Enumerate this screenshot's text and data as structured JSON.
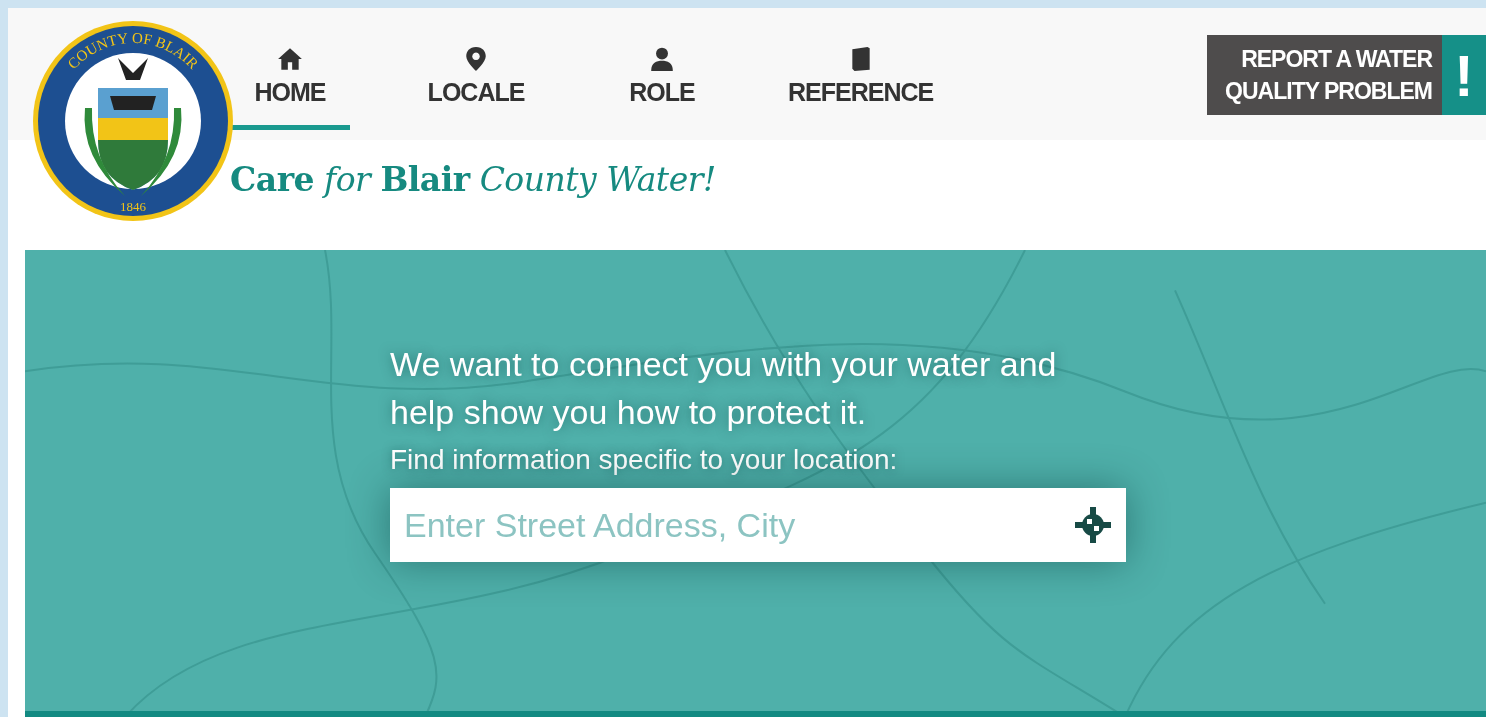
{
  "logo": {
    "top_text": "COUNTY OF BLAIR",
    "year": "1846"
  },
  "nav": [
    {
      "label": "HOME",
      "selected": true
    },
    {
      "label": "LOCALE",
      "selected": false
    },
    {
      "label": "ROLE",
      "selected": false
    },
    {
      "label": "REFERENCE",
      "selected": false
    }
  ],
  "report_button": {
    "label_line_1": "REPORT A WATER",
    "label_line_2": "QUALITY PROBLEM",
    "mark": "!"
  },
  "tagline": "**Care** *for* **Blair** *County Water!*",
  "hero": {
    "heading": "We want to connect you with your water and help show you how to protect it.",
    "subheading": "Find information specific to your location:",
    "search": {
      "placeholder": "Enter Street Address, City"
    }
  }
}
